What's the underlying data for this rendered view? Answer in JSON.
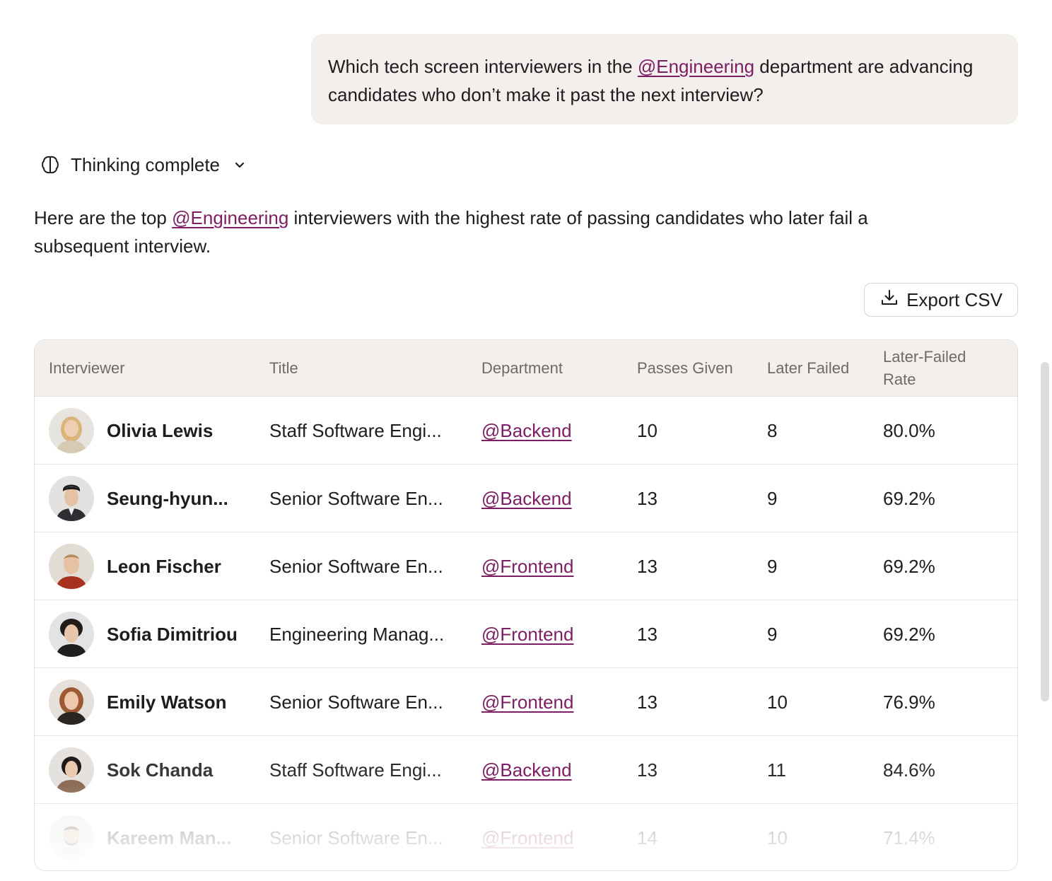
{
  "user_message": {
    "before": "Which tech screen interviewers in the ",
    "mention": "@Engineering",
    "after": " department are advancing candidates who don’t make it past the next interview?"
  },
  "thinking": {
    "label": "Thinking complete",
    "icon": "brain-icon"
  },
  "answer": {
    "before": "Here are the top ",
    "mention": "@Engineering",
    "after": " interviewers with the highest rate of passing candidates who later fail a subsequent interview."
  },
  "export": {
    "label": "Export CSV",
    "icon": "download-icon"
  },
  "table": {
    "headers": {
      "interviewer": "Interviewer",
      "title": "Title",
      "department": "Department",
      "passes": "Passes Given",
      "failed": "Later Failed",
      "rate_line1": "Later-Failed",
      "rate_line2": "Rate"
    },
    "rows": [
      {
        "name": "Olivia Lewis",
        "title": "Staff Software Engi...",
        "department": "@Backend",
        "passes": "10",
        "failed": "8",
        "rate": "80.0%"
      },
      {
        "name": "Seung-hyun...",
        "title": "Senior Software En...",
        "department": "@Backend",
        "passes": "13",
        "failed": "9",
        "rate": "69.2%"
      },
      {
        "name": "Leon Fischer",
        "title": "Senior Software En...",
        "department": "@Frontend",
        "passes": "13",
        "failed": "9",
        "rate": "69.2%"
      },
      {
        "name": "Sofia Dimitriou",
        "title": "Engineering Manag...",
        "department": "@Frontend",
        "passes": "13",
        "failed": "9",
        "rate": "69.2%"
      },
      {
        "name": "Emily Watson",
        "title": "Senior Software En...",
        "department": "@Frontend",
        "passes": "13",
        "failed": "10",
        "rate": "76.9%"
      },
      {
        "name": "Sok Chanda",
        "title": "Staff Software Engi...",
        "department": "@Backend",
        "passes": "13",
        "failed": "11",
        "rate": "84.6%"
      },
      {
        "name": "Kareem Man...",
        "title": "Senior Software En...",
        "department": "@Frontend",
        "passes": "14",
        "failed": "10",
        "rate": "71.4%"
      }
    ]
  },
  "colors": {
    "mention": "#7d1d63",
    "bubble": "#f2efed",
    "header_bg": "#f2efed"
  }
}
